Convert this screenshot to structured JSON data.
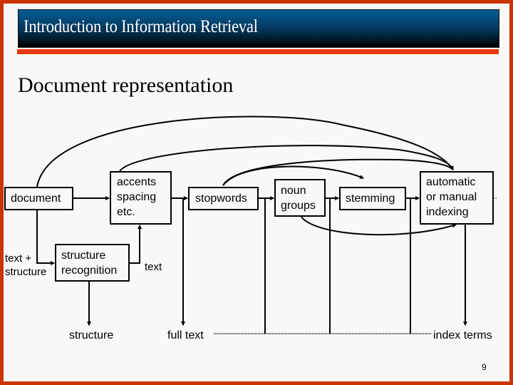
{
  "header": {
    "title": "Introduction to Information Retrieval"
  },
  "slide": {
    "title": "Document representation",
    "page_number": "9"
  },
  "diagram": {
    "nodes": {
      "document": "document",
      "accents": [
        "accents",
        "spacing",
        "etc."
      ],
      "structure_recognition": [
        "structure",
        "recognition"
      ],
      "stopwords": "stopwords",
      "noun_groups": [
        "noun",
        "groups"
      ],
      "stemming": "stemming",
      "indexing": [
        "automatic",
        "or manual",
        "indexing"
      ]
    },
    "edge_labels": {
      "text_plus_structure": [
        "text +",
        "structure"
      ],
      "text": "text"
    },
    "outputs": {
      "structure": "structure",
      "full_text": "full text",
      "index_terms": "index terms"
    }
  },
  "colors": {
    "frame": "#cc3300",
    "banner_top": "#055f98",
    "banner_bottom": "#000000",
    "rule": "#e8380d"
  }
}
